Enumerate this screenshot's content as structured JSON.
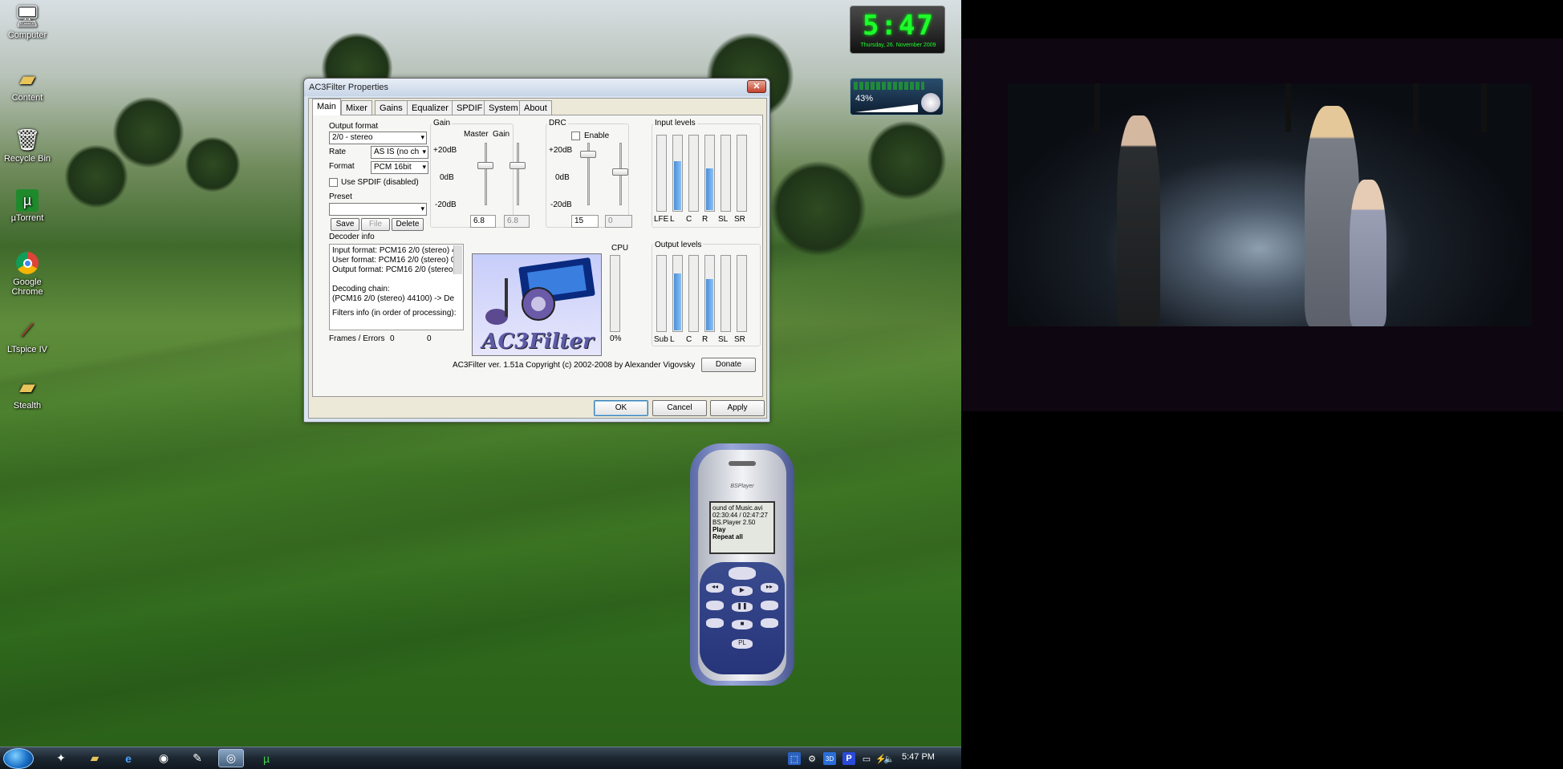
{
  "desktop_icons": [
    {
      "label": "Computer",
      "icon": "computer-icon"
    },
    {
      "label": "Content",
      "icon": "folder-icon"
    },
    {
      "label": "Recycle Bin",
      "icon": "recycle-bin-icon"
    },
    {
      "label": "µTorrent",
      "icon": "utorrent-icon"
    },
    {
      "label": "Google Chrome",
      "icon": "chrome-icon"
    },
    {
      "label": "LTspice IV",
      "icon": "ltspice-icon"
    },
    {
      "label": "Stealth",
      "icon": "folder-icon"
    }
  ],
  "gadgets": {
    "clock_time": "5:47",
    "clock_date": "Thursday, 26. November 2009",
    "volume_percent": "43%"
  },
  "taskbar": {
    "clock": "5:47 PM",
    "pinned": [
      "explorer-icon",
      "folder-icon",
      "ie-icon",
      "media-icon",
      "notepad-icon",
      "ac3filter-icon",
      "utorrent-icon"
    ]
  },
  "dialog": {
    "title": "AC3Filter Properties",
    "tabs": [
      "Main",
      "Mixer",
      "Gains",
      "Equalizer",
      "SPDIF",
      "System",
      "About"
    ],
    "selected_tab": "Main",
    "output_format_label": "Output format",
    "output_format_value": "2/0 - stereo",
    "rate_label": "Rate",
    "rate_value": "AS IS (no ch",
    "format_label": "Format",
    "format_value": "PCM 16bit",
    "use_spdif_label": "Use SPDIF (disabled)",
    "preset_label": "Preset",
    "preset_value": "",
    "save_label": "Save",
    "file_label": "File",
    "delete_label": "Delete",
    "gain_label": "Gain",
    "master_label": "Master",
    "gain_col_label": "Gain",
    "db_plus20": "+20dB",
    "db_0": "0dB",
    "db_minus20": "-20dB",
    "master_value": "6.8",
    "gain_value": "6.8",
    "drc_label": "DRC",
    "drc_enable_label": "Enable",
    "drc_value1": "15",
    "drc_value2": "0",
    "input_levels_label": "Input levels",
    "input_channels": [
      "LFE",
      "L",
      "C",
      "R",
      "SL",
      "SR"
    ],
    "input_levels": [
      0,
      0.65,
      0,
      0.55,
      0,
      0
    ],
    "decoder_info_label": "Decoder info",
    "decoder_lines": [
      "Input format: PCM16 2/0 (stereo) 4",
      "User format: PCM16 2/0 (stereo) 0",
      "Output format: PCM16 2/0 (stereo)",
      "",
      "Decoding chain:",
      "(PCM16 2/0 (stereo) 44100) -> De"
    ],
    "filters_info_label": "Filters info (in order of processing):",
    "frames_errors_label": "Frames / Errors",
    "frames_value": "0",
    "errors_value": "0",
    "cpu_label": "CPU",
    "cpu_value": "0%",
    "output_levels_label": "Output levels",
    "output_channels": [
      "Sub",
      "L",
      "C",
      "R",
      "SL",
      "SR"
    ],
    "output_levels": [
      0,
      0.75,
      0,
      0.68,
      0,
      0
    ],
    "logo_text": "AC3Filter",
    "copyright": "AC3Filter ver. 1.51a Copyright (c) 2002-2008 by Alexander Vigovsky",
    "donate_label": "Donate",
    "ok_label": "OK",
    "cancel_label": "Cancel",
    "apply_label": "Apply"
  },
  "phone": {
    "brand": "BSPlayer",
    "screen_lines": [
      "ound of Music.avi",
      "02:30:44 / 02:47:27",
      "BS.Player 2.50",
      "Play",
      "Repeat all"
    ],
    "pl_key": "PL"
  }
}
